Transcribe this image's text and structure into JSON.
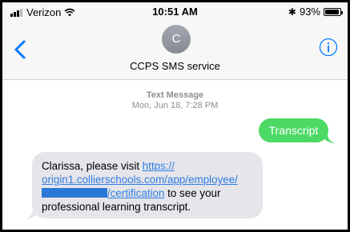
{
  "status_bar": {
    "carrier": "Verizon",
    "time": "10:51 AM",
    "battery_percent": "93%",
    "battery_level": 0.93,
    "icons": [
      "signal-icon",
      "wifi-icon",
      "bluetooth-icon",
      "battery-icon"
    ]
  },
  "header": {
    "back_icon": "chevron-left-icon",
    "avatar_initial": "C",
    "contact_name": "CCPS SMS service",
    "info_icon": "info-icon"
  },
  "thread": {
    "meta_label": "Text Message",
    "meta_date": "Mon, Jun 18, 7:28 PM",
    "sent_message": "Transcript",
    "received_message": {
      "text_before": "Clarissa, please visit ",
      "link_line1": "https://",
      "link_line2": "origin1.collierschools.com/app/employee/",
      "link_line3": "/certification",
      "text_after": " to see your professional learning transcript."
    }
  },
  "colors": {
    "sent_bubble": "#4cd964",
    "received_bubble": "#e5e5ea",
    "link": "#2f7de1",
    "accent": "#007aff",
    "header_background": "#f7f7f7"
  }
}
